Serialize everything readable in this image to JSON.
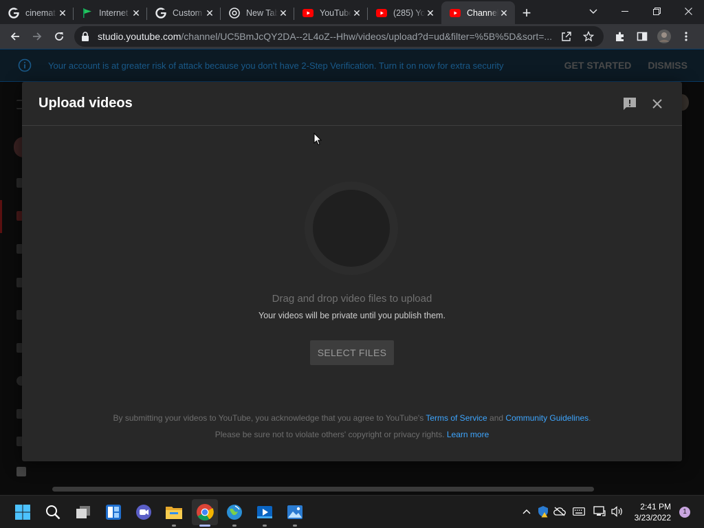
{
  "browser": {
    "tabs": [
      {
        "title": "cinemat",
        "icon": "google-icon"
      },
      {
        "title": "Internet",
        "icon": "green-flag-icon"
      },
      {
        "title": "Custom",
        "icon": "google-icon"
      },
      {
        "title": "New Tab",
        "icon": "chrome-icon"
      },
      {
        "title": "YouTube",
        "icon": "youtube-icon"
      },
      {
        "title": "(285) Yo",
        "icon": "youtube-icon"
      },
      {
        "title": "Channel",
        "icon": "youtube-icon",
        "active": true
      }
    ],
    "url_host": "studio.youtube.com",
    "url_path": "/channel/UC5BmJcQY2DA--2L4oZ--Hhw/videos/upload?d=ud&filter=%5B%5D&sort=..."
  },
  "banner": {
    "message": "Your account is at greater risk of attack because you don't have 2-Step Verification. Turn it on now for extra security",
    "get_started": "GET STARTED",
    "dismiss": "DISMISS"
  },
  "dialog": {
    "title": "Upload videos",
    "drag_text": "Drag and drop video files to upload",
    "private_text": "Your videos will be private until you publish them.",
    "select_button": "SELECT FILES",
    "legal_prefix": "By submitting your videos to YouTube, you acknowledge that you agree to YouTube's ",
    "terms_link": "Terms of Service",
    "legal_and": " and ",
    "guidelines_link": "Community Guidelines",
    "legal_period": ".",
    "copyright_text": "Please be sure not to violate others' copyright or privacy rights. ",
    "learn_more": "Learn more"
  },
  "taskbar": {
    "time": "2:41 PM",
    "date": "3/23/2022",
    "notification_count": "1"
  },
  "colors": {
    "accent_link": "#3ea6ff",
    "youtube_red": "#ff0000",
    "dialog_bg": "#282828"
  }
}
